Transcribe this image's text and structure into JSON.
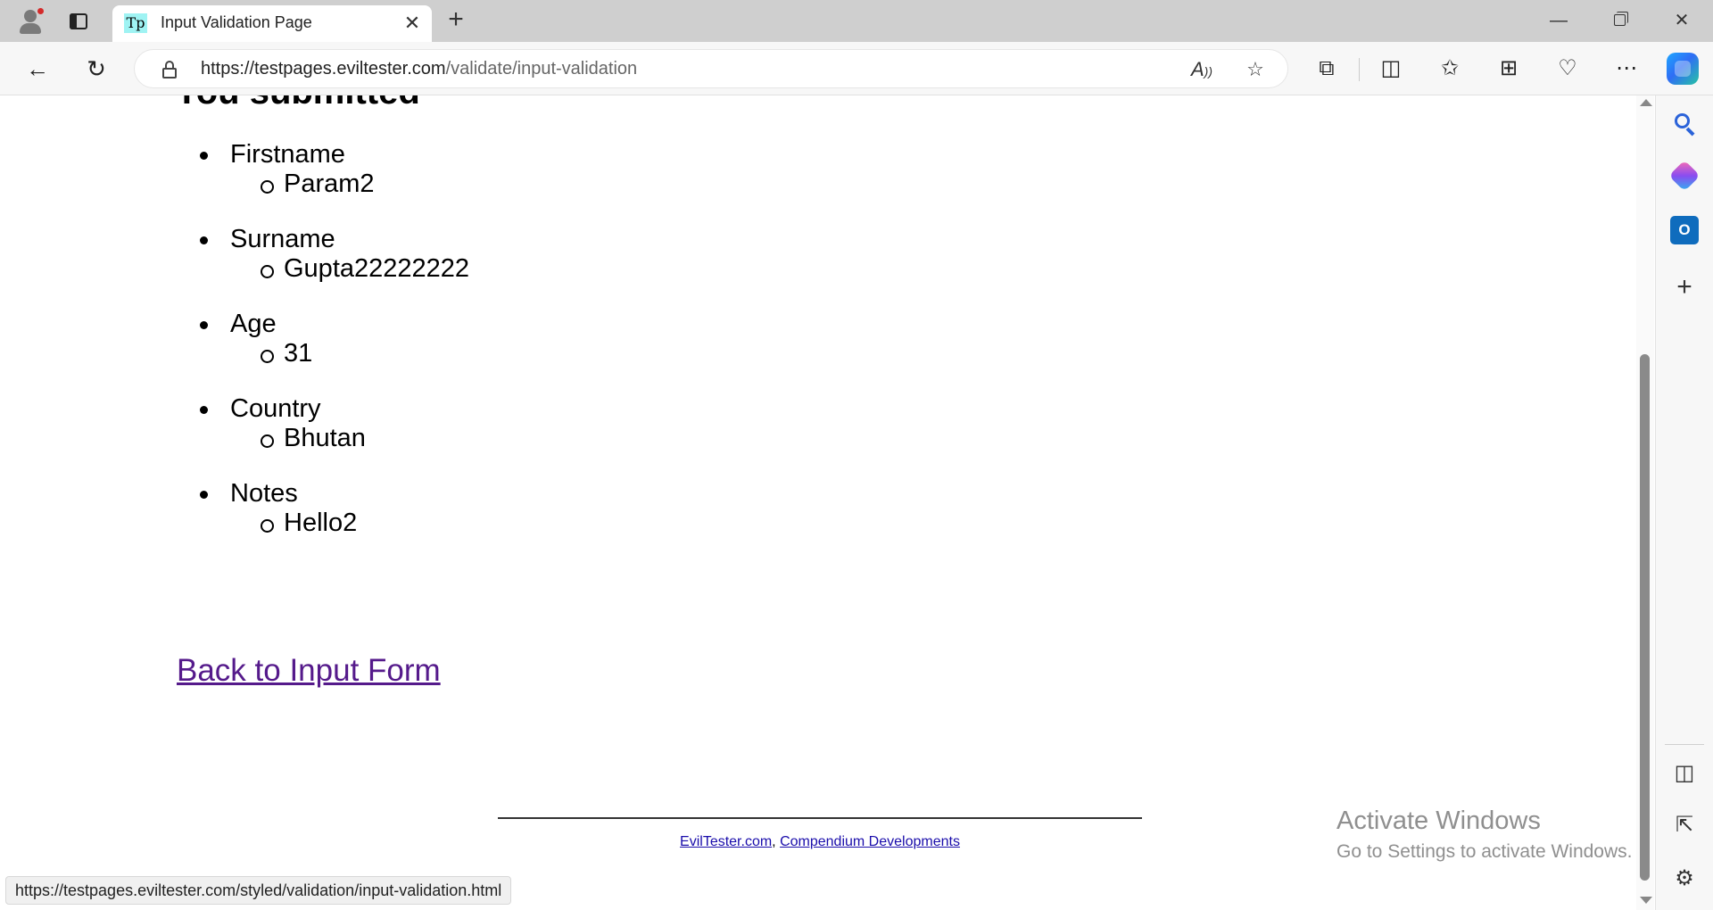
{
  "browser": {
    "tab": {
      "favicon_text": "Tp",
      "title": "Input Validation Page"
    },
    "address": {
      "host": "https://testpages.eviltester.com",
      "path": "/validate/input-validation"
    }
  },
  "page": {
    "heading": "You submitted",
    "results": [
      {
        "label": "Firstname",
        "value": "Param2"
      },
      {
        "label": "Surname",
        "value": "Gupta22222222"
      },
      {
        "label": "Age",
        "value": "31"
      },
      {
        "label": "Country",
        "value": "Bhutan"
      },
      {
        "label": "Notes",
        "value": "Hello2"
      }
    ],
    "back_link": "Back to Input Form",
    "footer": {
      "link1": "EvilTester.com",
      "separator": ",",
      "link2": "Compendium Developments"
    },
    "status_url": "https://testpages.eviltester.com/styled/validation/input-validation.html"
  },
  "watermark": {
    "line1": "Activate Windows",
    "line2": "Go to Settings to activate Windows."
  },
  "icons": {
    "back": "arrow-left-icon",
    "refresh": "refresh-icon",
    "lock": "lock-icon",
    "read_aloud": "read-aloud-icon",
    "favorite": "star-icon",
    "extensions": "puzzle-icon",
    "split": "split-screen-icon",
    "favorites": "favorites-icon",
    "collections": "collections-icon",
    "health": "browser-essentials-icon",
    "more": "more-icon",
    "copilot": "copilot-icon"
  },
  "colors": {
    "visited_link": "#551a8b",
    "link": "#1a0dab",
    "tab_strip": "#cfcfcf"
  }
}
